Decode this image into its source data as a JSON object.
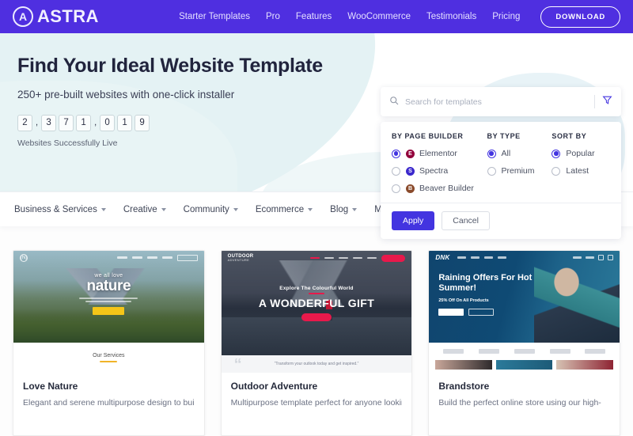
{
  "brand": {
    "logo_mark": "astra-a-mark",
    "name": "ASTRA",
    "primary_color": "#4f2fe0",
    "accent_color": "#4334e0"
  },
  "header": {
    "nav": [
      {
        "label": "Starter Templates"
      },
      {
        "label": "Pro"
      },
      {
        "label": "Features"
      },
      {
        "label": "WooCommerce"
      },
      {
        "label": "Testimonials"
      },
      {
        "label": "Pricing"
      }
    ],
    "download_label": "DOWNLOAD"
  },
  "hero": {
    "title": "Find Your Ideal Website Template",
    "subtitle": "250+ pre-built websites with one-click installer",
    "counter_digits": [
      "2",
      ",",
      "3",
      "7",
      "1",
      ",",
      "0",
      "1",
      "9"
    ],
    "counter_label": "Websites Successfully Live"
  },
  "search": {
    "placeholder": "Search for templates",
    "value": "",
    "search_icon": "search-icon",
    "filter_icon": "filter-funnel-icon"
  },
  "filters": {
    "groups": [
      {
        "heading": "BY PAGE BUILDER",
        "options": [
          {
            "label": "Elementor",
            "selected": true,
            "icon": "elementor-icon",
            "icon_color": "#92003b",
            "glyph": "E"
          },
          {
            "label": "Spectra",
            "selected": false,
            "icon": "spectra-icon",
            "icon_color": "#3b28cc",
            "glyph": "S"
          },
          {
            "label": "Beaver Builder",
            "selected": false,
            "icon": "beaver-builder-icon",
            "icon_color": "#8a4a2b",
            "glyph": "B"
          }
        ]
      },
      {
        "heading": "BY TYPE",
        "options": [
          {
            "label": "All",
            "selected": true
          },
          {
            "label": "Premium",
            "selected": false
          }
        ]
      },
      {
        "heading": "SORT BY",
        "options": [
          {
            "label": "Popular",
            "selected": true
          },
          {
            "label": "Latest",
            "selected": false
          }
        ]
      }
    ],
    "apply_label": "Apply",
    "cancel_label": "Cancel"
  },
  "categories": [
    {
      "label": "Business & Services"
    },
    {
      "label": "Creative"
    },
    {
      "label": "Community"
    },
    {
      "label": "Ecommerce"
    },
    {
      "label": "Blog"
    },
    {
      "label": "Multipurpose"
    }
  ],
  "templates": [
    {
      "title": "Love Nature",
      "description": "Elegant and serene multipurpose design to build",
      "thumb": {
        "logo": "(N)",
        "kicker": "we all love",
        "headline": "nature",
        "section_title": "Our Services"
      }
    },
    {
      "title": "Outdoor Adventure",
      "description": "Multipurpose template perfect for anyone looking",
      "thumb": {
        "logo": "OUTDOOR",
        "logo_sub": "ADVENTURE",
        "kicker": "Explore The Colourful World",
        "headline": "A WONDERFUL GIFT",
        "quote": "“Transform your outlook today and get inspired.”"
      }
    },
    {
      "title": "Brandstore",
      "description": "Build the perfect online store using our high-",
      "thumb": {
        "logo": "DNK",
        "headline": "Raining Offers For Hot Summer!",
        "subline": "25% Off On All Products"
      }
    }
  ]
}
